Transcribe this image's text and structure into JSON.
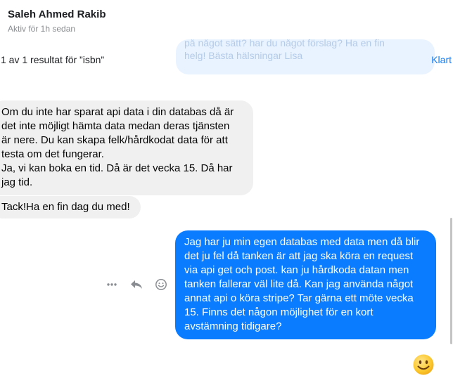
{
  "header": {
    "contact_name": "Saleh Ahmed Rakib",
    "status": "Aktiv för 1h sedan"
  },
  "search": {
    "result_text": "1 av 1 resultat för ”isbn”",
    "done_label": "Klart",
    "faded_message_lines": [
      "på något sätt? har du något förslag? Ha en fin",
      "helg! Bästa hälsningar Lisa"
    ]
  },
  "messages": [
    {
      "direction": "incoming",
      "lines": [
        "Om du inte har sparat  api data  i din databas då är",
        "det inte möjligt hämta data medan deras tjänsten",
        "är nere. Du kan skapa felk/hårdkodat data för att",
        "testa om det fungerar.",
        "Ja, vi kan boka en tid. Då är det vecka 15. Då har",
        "jag tid."
      ]
    },
    {
      "direction": "incoming",
      "lines": [
        "Tack!Ha en fin dag du med!"
      ]
    },
    {
      "direction": "outgoing",
      "lines": [
        "Jag har ju min egen databas med data men då blir",
        "det ju fel då tanken är att jag ska köra en request",
        "via api get och post. kan ju hårdkoda datan men",
        "tanken fallerar väl lite då. Kan jag använda något",
        "annat api o köra stripe?  Tar gärna ett möte vecka",
        "15. Finns det någon möjlighet för en kort",
        "avstämning tidigare?"
      ]
    }
  ],
  "message_actions": [
    "more-icon",
    "reply-icon",
    "react-icon"
  ],
  "composer": {
    "emoji_icon": "smiley-emoji-icon"
  },
  "colors": {
    "outgoing_bubble": "#0a7cff",
    "incoming_bubble": "#f0f0f0",
    "link": "#0a7cff",
    "muted_text": "#8a8d91"
  }
}
